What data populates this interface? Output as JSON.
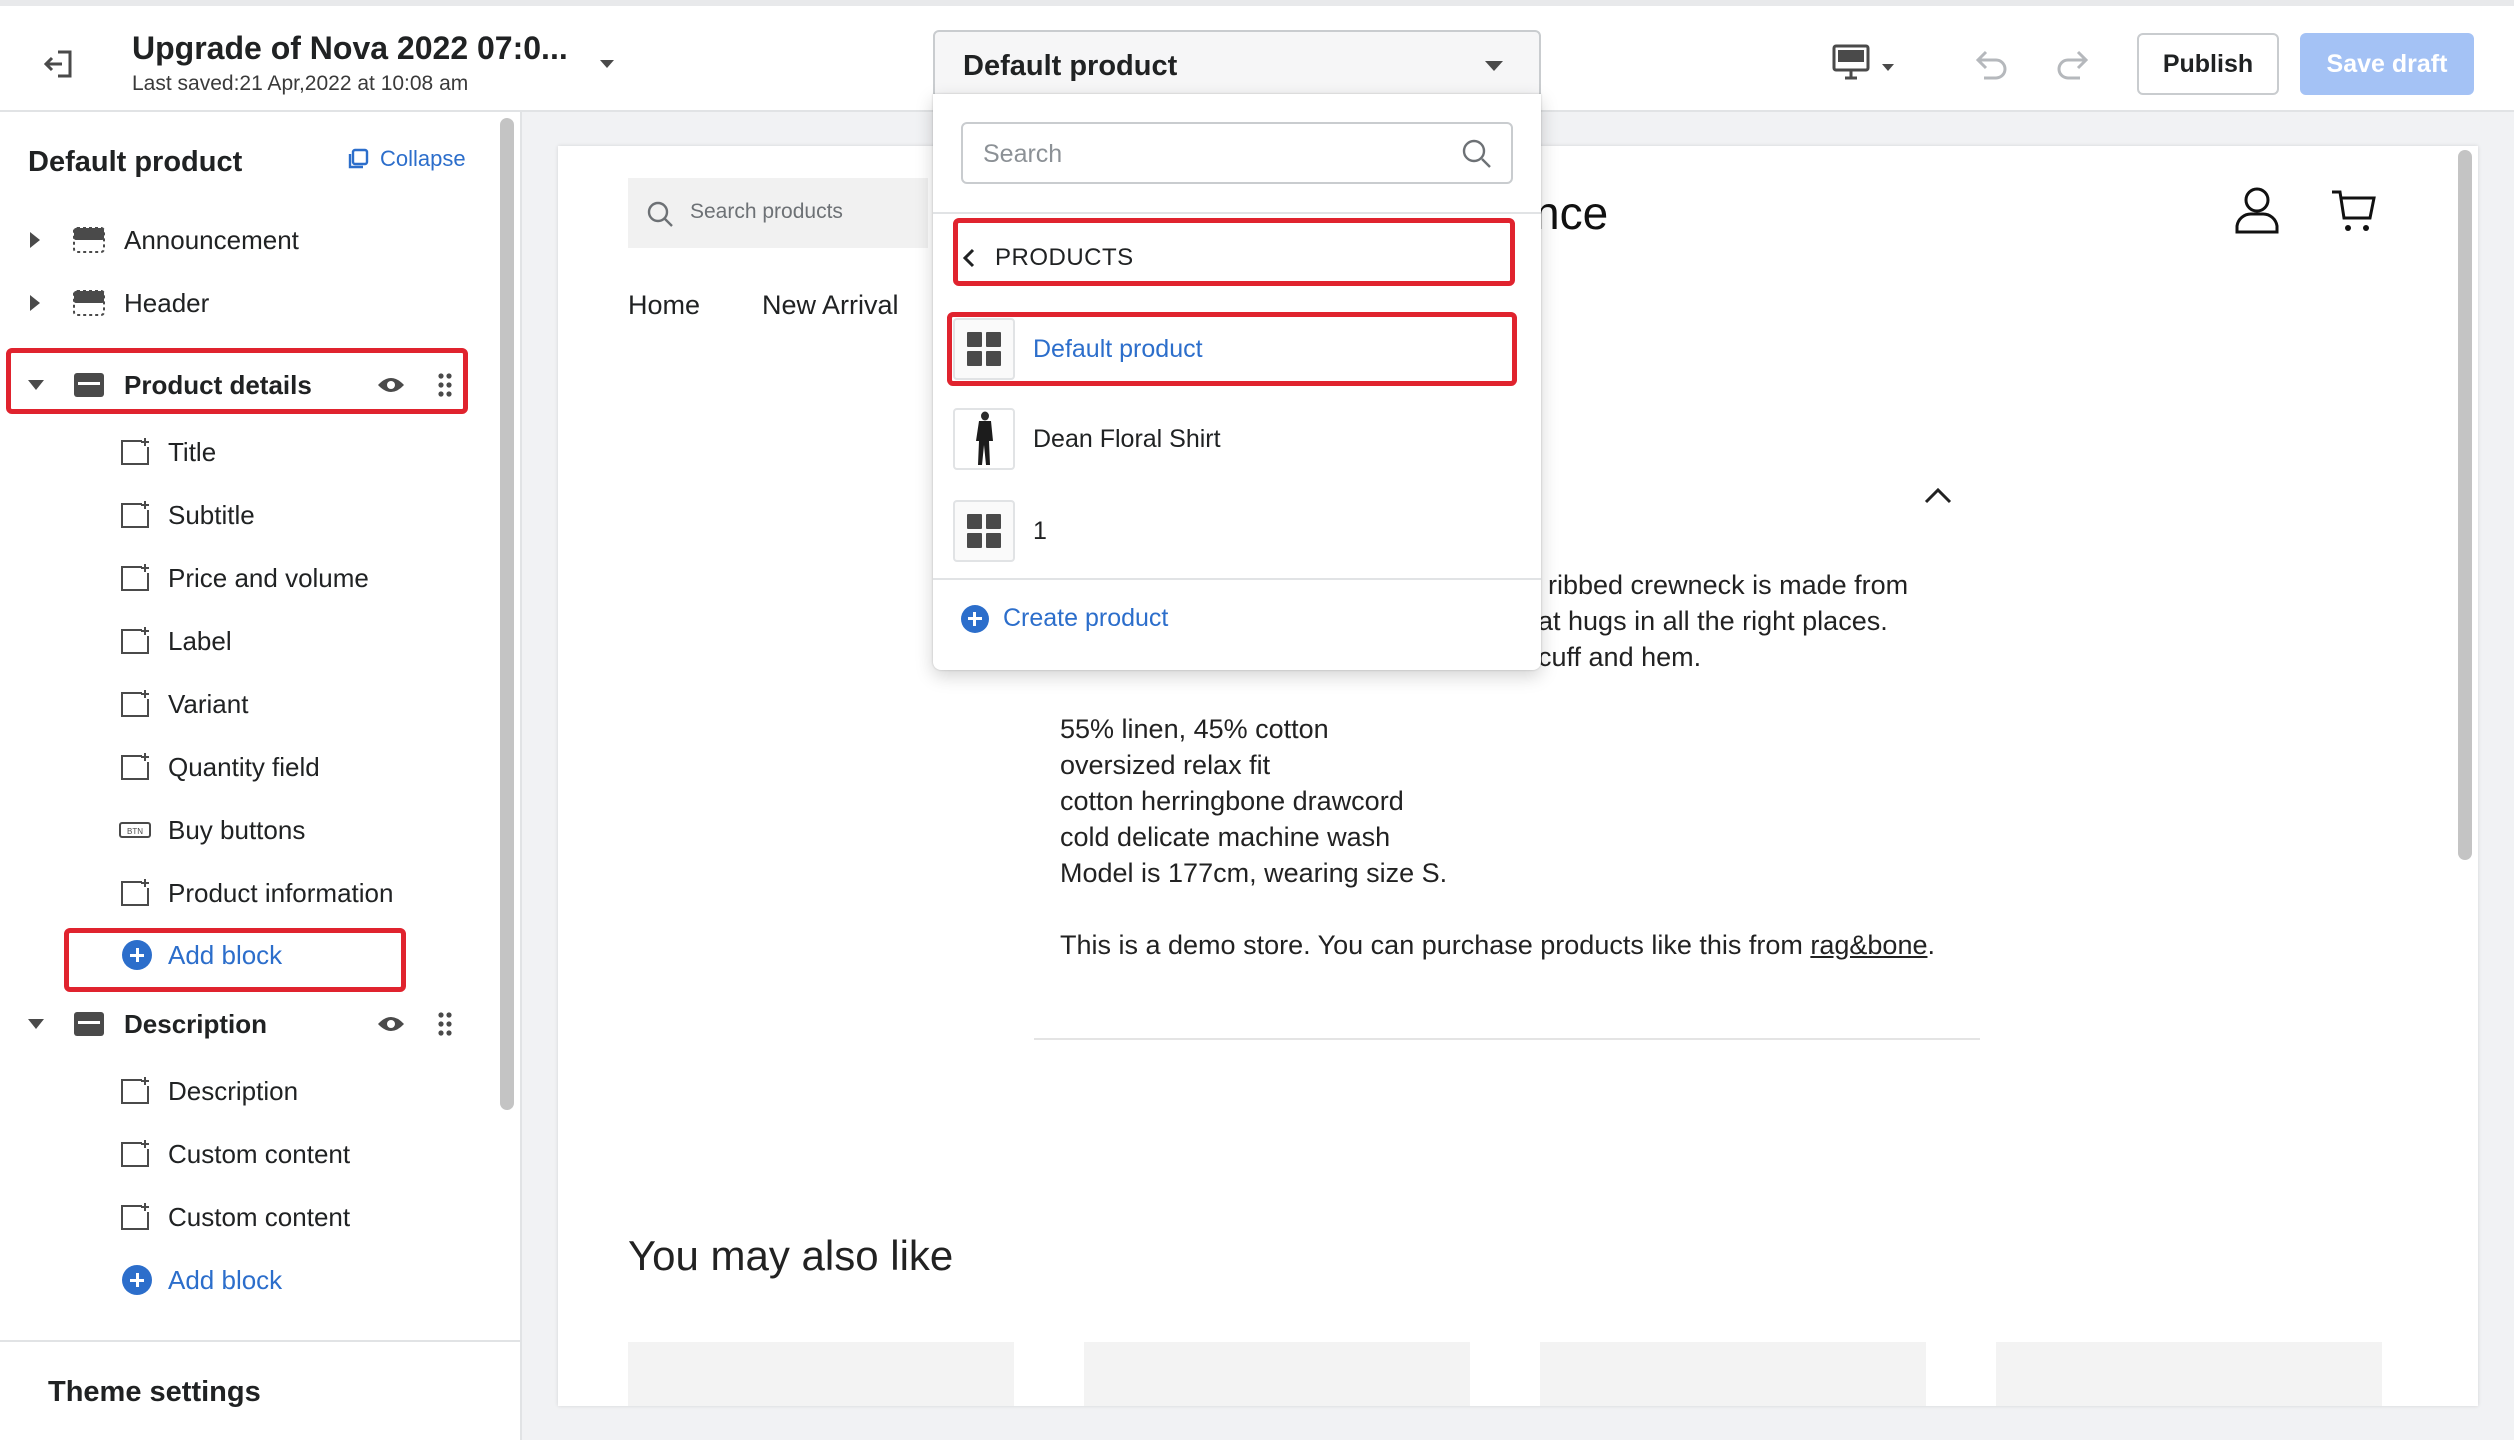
{
  "header": {
    "title": "Upgrade of Nova 2022 07:0...",
    "last_saved": "Last saved:21 Apr,2022 at 10:08 am",
    "page_select": "Default product",
    "publish_label": "Publish",
    "save_label": "Save draft"
  },
  "sidebar": {
    "heading": "Default product",
    "collapse_label": "Collapse",
    "sections": [
      {
        "label": "Announcement"
      },
      {
        "label": "Header"
      },
      {
        "label": "Product details",
        "blocks": [
          "Title",
          "Subtitle",
          "Price and volume",
          "Label",
          "Variant",
          "Quantity field",
          "Buy buttons",
          "Product information"
        ],
        "add_label": "Add block"
      },
      {
        "label": "Description",
        "blocks": [
          "Description",
          "Custom content",
          "Custom content"
        ],
        "add_label": "Add block"
      }
    ],
    "theme_settings": "Theme settings"
  },
  "dropdown": {
    "search_placeholder": "Search",
    "back_label": "PRODUCTS",
    "items": [
      {
        "label": "Default product",
        "active": true
      },
      {
        "label": "Dean Floral Shirt",
        "active": false
      },
      {
        "label": "1",
        "active": false
      }
    ],
    "create_label": "Create product"
  },
  "preview": {
    "search_placeholder": "Search products",
    "logo_partial": "nce",
    "nav": [
      "Home",
      "New Arrival"
    ],
    "description_lines": [
      "ribbed crewneck is made from",
      "at hugs in all the right places.",
      "cuff and hem."
    ],
    "details": [
      "55% linen, 45% cotton",
      "oversized relax fit",
      "cotton herringbone drawcord",
      "cold delicate machine wash",
      "Model is 177cm, wearing size S."
    ],
    "demo_text": "This is a demo store. You can purchase products like this from ",
    "demo_link": "rag&bone",
    "demo_end": ".",
    "also_like": "You may also like"
  },
  "colors": {
    "accent": "#2c6ecb",
    "highlight": "#e0232e",
    "save_disabled": "#a4c2f5"
  }
}
